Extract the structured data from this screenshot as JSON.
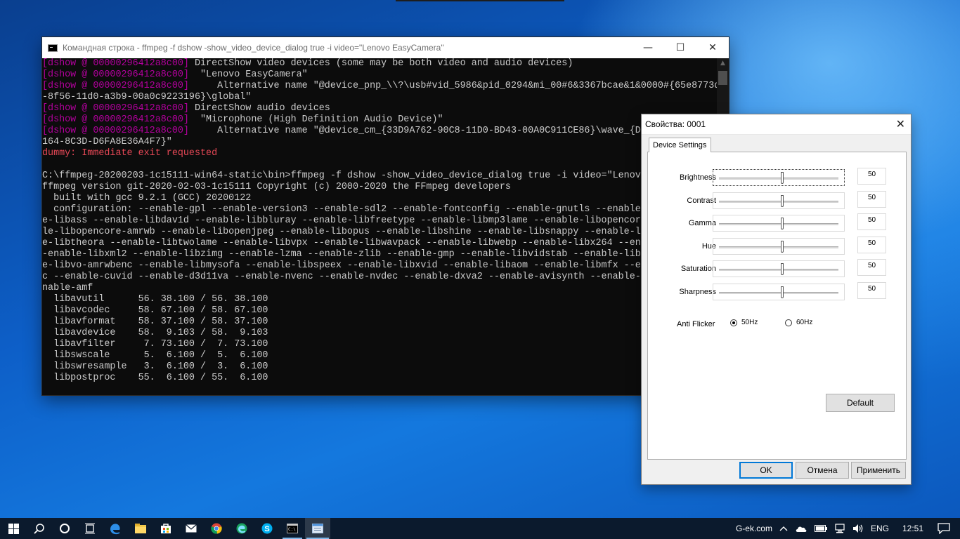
{
  "console": {
    "title": "Командная строка - ffmpeg  -f dshow -show_video_device_dialog true -i video=\"Lenovo EasyCamera\"",
    "controls": {
      "minimize": "—",
      "maximize": "☐",
      "close": "✕"
    },
    "lines": [
      {
        "prefix": "[dshow @ 00000296412a8c00] ",
        "text": "DirectShow video devices (some may be both video and audio devices)"
      },
      {
        "prefix": "[dshow @ 00000296412a8c00] ",
        "text": " \"Lenovo EasyCamera\""
      },
      {
        "prefix": "[dshow @ 00000296412a8c00] ",
        "text": "    Alternative name \"@device_pnp_\\\\?\\usb#vid_5986&pid_0294&mi_00#6&3367bcae&1&0000#{65e8773d"
      },
      {
        "prefix": "",
        "text": "-8f56-11d0-a3b9-00a0c9223196}\\global\""
      },
      {
        "prefix": "[dshow @ 00000296412a8c00] ",
        "text": "DirectShow audio devices"
      },
      {
        "prefix": "[dshow @ 00000296412a8c00] ",
        "text": " \"Microphone (High Definition Audio Device)\""
      },
      {
        "prefix": "[dshow @ 00000296412a8c00] ",
        "text": "    Alternative name \"@device_cm_{33D9A762-90C8-11D0-BD43-00A0C911CE86}\\wave_{D5"
      },
      {
        "prefix": "",
        "text": "164-8C3D-D6FA8E36A4F7}\""
      },
      {
        "prefix": "",
        "text": "",
        "error": "dummy: Immediate exit requested"
      },
      {
        "prefix": "",
        "text": ""
      },
      {
        "prefix": "",
        "text": "C:\\ffmpeg-20200203-1c15111-win64-static\\bin>ffmpeg -f dshow -show_video_device_dialog true -i video=\"Lenovo"
      },
      {
        "prefix": "",
        "text": "ffmpeg version git-2020-02-03-1c15111 Copyright (c) 2000-2020 the FFmpeg developers"
      },
      {
        "prefix": "",
        "text": "  built with gcc 9.2.1 (GCC) 20200122"
      },
      {
        "prefix": "",
        "text": "  configuration: --enable-gpl --enable-version3 --enable-sdl2 --enable-fontconfig --enable-gnutls --enable-"
      },
      {
        "prefix": "",
        "text": "e-libass --enable-libdav1d --enable-libbluray --enable-libfreetype --enable-libmp3lame --enable-libopencore"
      },
      {
        "prefix": "",
        "text": "le-libopencore-amrwb --enable-libopenjpeg --enable-libopus --enable-libshine --enable-libsnappy --enable-li"
      },
      {
        "prefix": "",
        "text": "e-libtheora --enable-libtwolame --enable-libvpx --enable-libwavpack --enable-libwebp --enable-libx264 --ena"
      },
      {
        "prefix": "",
        "text": "-enable-libxml2 --enable-libzimg --enable-lzma --enable-zlib --enable-gmp --enable-libvidstab --enable-libv"
      },
      {
        "prefix": "",
        "text": "e-libvo-amrwbenc --enable-libmysofa --enable-libspeex --enable-libxvid --enable-libaom --enable-libmfx --en"
      },
      {
        "prefix": "",
        "text": "c --enable-cuvid --enable-d3d11va --enable-nvenc --enable-nvdec --enable-dxva2 --enable-avisynth --enable-l"
      },
      {
        "prefix": "",
        "text": "nable-amf"
      },
      {
        "prefix": "",
        "text": "  libavutil      56. 38.100 / 56. 38.100"
      },
      {
        "prefix": "",
        "text": "  libavcodec     58. 67.100 / 58. 67.100"
      },
      {
        "prefix": "",
        "text": "  libavformat    58. 37.100 / 58. 37.100"
      },
      {
        "prefix": "",
        "text": "  libavdevice    58.  9.103 / 58.  9.103"
      },
      {
        "prefix": "",
        "text": "  libavfilter     7. 73.100 /  7. 73.100"
      },
      {
        "prefix": "",
        "text": "  libswscale      5.  6.100 /  5.  6.100"
      },
      {
        "prefix": "",
        "text": "  libswresample   3.  6.100 /  3.  6.100"
      },
      {
        "prefix": "",
        "text": "  libpostproc    55.  6.100 / 55.  6.100"
      }
    ]
  },
  "dialog": {
    "title": "Свойства: 0001",
    "close": "✕",
    "tab": "Device Settings",
    "sliders": [
      {
        "label": "Brightness",
        "value": "50",
        "fraction": 0.5
      },
      {
        "label": "Contrast",
        "value": "50",
        "fraction": 0.5
      },
      {
        "label": "Gamma",
        "value": "50",
        "fraction": 0.5
      },
      {
        "label": "Hue",
        "value": "50",
        "fraction": 0.5
      },
      {
        "label": "Saturation",
        "value": "50",
        "fraction": 0.5
      },
      {
        "label": "Sharpness",
        "value": "50",
        "fraction": 0.5
      }
    ],
    "anti_flicker": {
      "label": "Anti Flicker",
      "options": [
        "50Hz",
        "60Hz"
      ],
      "selected": "50Hz"
    },
    "buttons": {
      "default": "Default",
      "ok": "OK",
      "cancel": "Отмена",
      "apply": "Применить"
    }
  },
  "taskbar": {
    "apps": [
      "start-icon",
      "search-icon",
      "cortana-icon",
      "task-view-icon",
      "edge-icon",
      "file-explorer-icon",
      "store-icon",
      "mail-icon",
      "chrome-icon",
      "edge-dev-icon",
      "skype-icon",
      "command-prompt-icon",
      "properties-app-icon"
    ],
    "tray": {
      "site": "G-ek.com",
      "language": "ENG",
      "time": "12:51"
    }
  }
}
